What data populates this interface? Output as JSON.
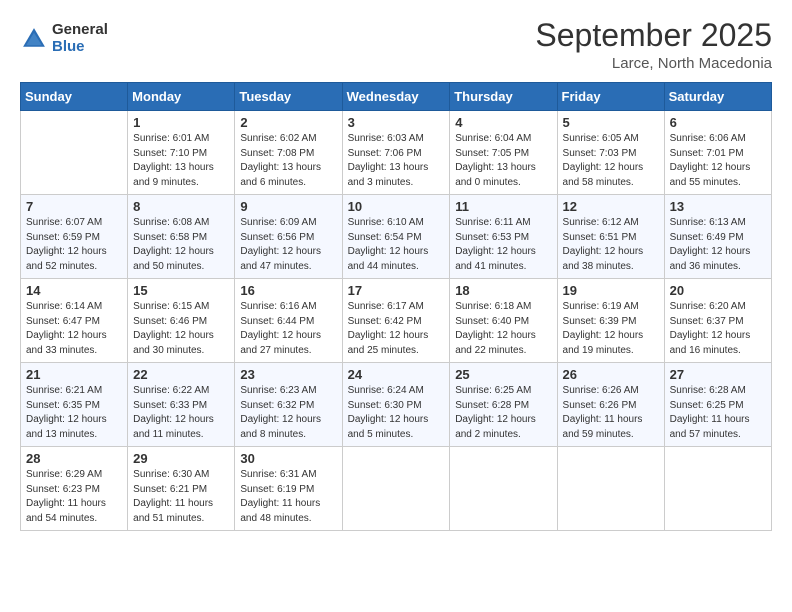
{
  "header": {
    "logo_general": "General",
    "logo_blue": "Blue",
    "month_title": "September 2025",
    "location": "Larce, North Macedonia"
  },
  "weekdays": [
    "Sunday",
    "Monday",
    "Tuesday",
    "Wednesday",
    "Thursday",
    "Friday",
    "Saturday"
  ],
  "rows": [
    [
      {
        "day": "",
        "sunrise": "",
        "sunset": "",
        "daylight": ""
      },
      {
        "day": "1",
        "sunrise": "Sunrise: 6:01 AM",
        "sunset": "Sunset: 7:10 PM",
        "daylight": "Daylight: 13 hours and 9 minutes."
      },
      {
        "day": "2",
        "sunrise": "Sunrise: 6:02 AM",
        "sunset": "Sunset: 7:08 PM",
        "daylight": "Daylight: 13 hours and 6 minutes."
      },
      {
        "day": "3",
        "sunrise": "Sunrise: 6:03 AM",
        "sunset": "Sunset: 7:06 PM",
        "daylight": "Daylight: 13 hours and 3 minutes."
      },
      {
        "day": "4",
        "sunrise": "Sunrise: 6:04 AM",
        "sunset": "Sunset: 7:05 PM",
        "daylight": "Daylight: 13 hours and 0 minutes."
      },
      {
        "day": "5",
        "sunrise": "Sunrise: 6:05 AM",
        "sunset": "Sunset: 7:03 PM",
        "daylight": "Daylight: 12 hours and 58 minutes."
      },
      {
        "day": "6",
        "sunrise": "Sunrise: 6:06 AM",
        "sunset": "Sunset: 7:01 PM",
        "daylight": "Daylight: 12 hours and 55 minutes."
      }
    ],
    [
      {
        "day": "7",
        "sunrise": "Sunrise: 6:07 AM",
        "sunset": "Sunset: 6:59 PM",
        "daylight": "Daylight: 12 hours and 52 minutes."
      },
      {
        "day": "8",
        "sunrise": "Sunrise: 6:08 AM",
        "sunset": "Sunset: 6:58 PM",
        "daylight": "Daylight: 12 hours and 50 minutes."
      },
      {
        "day": "9",
        "sunrise": "Sunrise: 6:09 AM",
        "sunset": "Sunset: 6:56 PM",
        "daylight": "Daylight: 12 hours and 47 minutes."
      },
      {
        "day": "10",
        "sunrise": "Sunrise: 6:10 AM",
        "sunset": "Sunset: 6:54 PM",
        "daylight": "Daylight: 12 hours and 44 minutes."
      },
      {
        "day": "11",
        "sunrise": "Sunrise: 6:11 AM",
        "sunset": "Sunset: 6:53 PM",
        "daylight": "Daylight: 12 hours and 41 minutes."
      },
      {
        "day": "12",
        "sunrise": "Sunrise: 6:12 AM",
        "sunset": "Sunset: 6:51 PM",
        "daylight": "Daylight: 12 hours and 38 minutes."
      },
      {
        "day": "13",
        "sunrise": "Sunrise: 6:13 AM",
        "sunset": "Sunset: 6:49 PM",
        "daylight": "Daylight: 12 hours and 36 minutes."
      }
    ],
    [
      {
        "day": "14",
        "sunrise": "Sunrise: 6:14 AM",
        "sunset": "Sunset: 6:47 PM",
        "daylight": "Daylight: 12 hours and 33 minutes."
      },
      {
        "day": "15",
        "sunrise": "Sunrise: 6:15 AM",
        "sunset": "Sunset: 6:46 PM",
        "daylight": "Daylight: 12 hours and 30 minutes."
      },
      {
        "day": "16",
        "sunrise": "Sunrise: 6:16 AM",
        "sunset": "Sunset: 6:44 PM",
        "daylight": "Daylight: 12 hours and 27 minutes."
      },
      {
        "day": "17",
        "sunrise": "Sunrise: 6:17 AM",
        "sunset": "Sunset: 6:42 PM",
        "daylight": "Daylight: 12 hours and 25 minutes."
      },
      {
        "day": "18",
        "sunrise": "Sunrise: 6:18 AM",
        "sunset": "Sunset: 6:40 PM",
        "daylight": "Daylight: 12 hours and 22 minutes."
      },
      {
        "day": "19",
        "sunrise": "Sunrise: 6:19 AM",
        "sunset": "Sunset: 6:39 PM",
        "daylight": "Daylight: 12 hours and 19 minutes."
      },
      {
        "day": "20",
        "sunrise": "Sunrise: 6:20 AM",
        "sunset": "Sunset: 6:37 PM",
        "daylight": "Daylight: 12 hours and 16 minutes."
      }
    ],
    [
      {
        "day": "21",
        "sunrise": "Sunrise: 6:21 AM",
        "sunset": "Sunset: 6:35 PM",
        "daylight": "Daylight: 12 hours and 13 minutes."
      },
      {
        "day": "22",
        "sunrise": "Sunrise: 6:22 AM",
        "sunset": "Sunset: 6:33 PM",
        "daylight": "Daylight: 12 hours and 11 minutes."
      },
      {
        "day": "23",
        "sunrise": "Sunrise: 6:23 AM",
        "sunset": "Sunset: 6:32 PM",
        "daylight": "Daylight: 12 hours and 8 minutes."
      },
      {
        "day": "24",
        "sunrise": "Sunrise: 6:24 AM",
        "sunset": "Sunset: 6:30 PM",
        "daylight": "Daylight: 12 hours and 5 minutes."
      },
      {
        "day": "25",
        "sunrise": "Sunrise: 6:25 AM",
        "sunset": "Sunset: 6:28 PM",
        "daylight": "Daylight: 12 hours and 2 minutes."
      },
      {
        "day": "26",
        "sunrise": "Sunrise: 6:26 AM",
        "sunset": "Sunset: 6:26 PM",
        "daylight": "Daylight: 11 hours and 59 minutes."
      },
      {
        "day": "27",
        "sunrise": "Sunrise: 6:28 AM",
        "sunset": "Sunset: 6:25 PM",
        "daylight": "Daylight: 11 hours and 57 minutes."
      }
    ],
    [
      {
        "day": "28",
        "sunrise": "Sunrise: 6:29 AM",
        "sunset": "Sunset: 6:23 PM",
        "daylight": "Daylight: 11 hours and 54 minutes."
      },
      {
        "day": "29",
        "sunrise": "Sunrise: 6:30 AM",
        "sunset": "Sunset: 6:21 PM",
        "daylight": "Daylight: 11 hours and 51 minutes."
      },
      {
        "day": "30",
        "sunrise": "Sunrise: 6:31 AM",
        "sunset": "Sunset: 6:19 PM",
        "daylight": "Daylight: 11 hours and 48 minutes."
      },
      {
        "day": "",
        "sunrise": "",
        "sunset": "",
        "daylight": ""
      },
      {
        "day": "",
        "sunrise": "",
        "sunset": "",
        "daylight": ""
      },
      {
        "day": "",
        "sunrise": "",
        "sunset": "",
        "daylight": ""
      },
      {
        "day": "",
        "sunrise": "",
        "sunset": "",
        "daylight": ""
      }
    ]
  ]
}
